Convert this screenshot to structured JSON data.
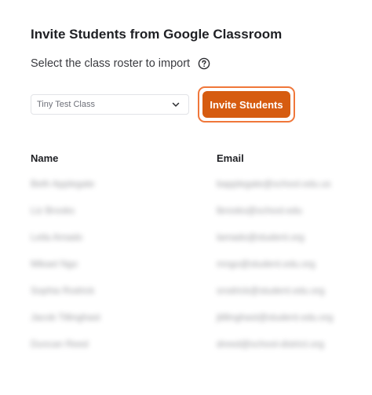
{
  "dialog": {
    "title": "Invite Students from Google Classroom",
    "subtitle": "Select the class roster to import",
    "help_icon": "question-circle-icon"
  },
  "roster_select": {
    "selected": "Tiny Test Class",
    "icon": "chevron-down-icon"
  },
  "invite_button": {
    "label": "Invite Students",
    "color": "#d65c10",
    "focus_ring_color": "#f0773a"
  },
  "table": {
    "headers": {
      "name": "Name",
      "email": "Email"
    },
    "rows": [
      {
        "name": "Beth Applegate",
        "email": "bapplegate@school.edu.us"
      },
      {
        "name": "Liz Brooks",
        "email": "lbrooks@school.edu"
      },
      {
        "name": "Leila Amado",
        "email": "lamado@student.org"
      },
      {
        "name": "Mikael Ngo",
        "email": "mngo@student.edu.org"
      },
      {
        "name": "Sophia Rodrick",
        "email": "srodrick@student.edu.org"
      },
      {
        "name": "Jacob Tillinghast",
        "email": "jtillinghast@student.edu.org"
      },
      {
        "name": "Duncan Reed",
        "email": "dreed@school-district.org"
      }
    ]
  }
}
